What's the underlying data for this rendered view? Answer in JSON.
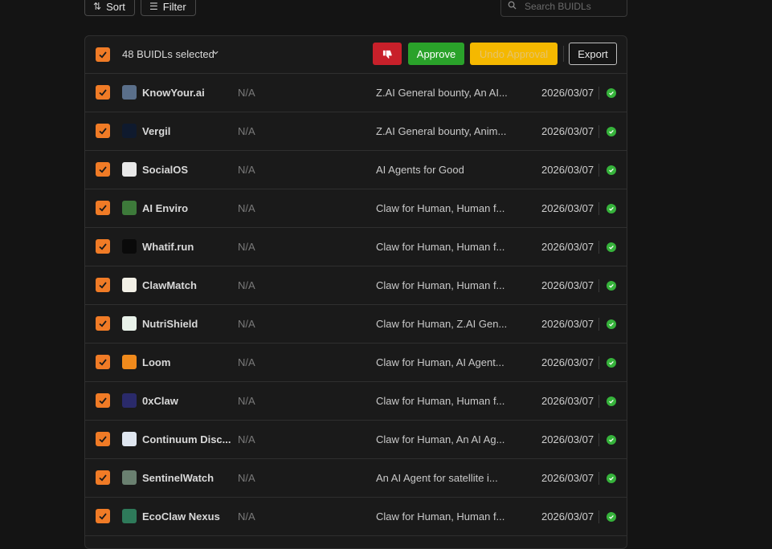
{
  "toolbar": {
    "sort_label": "Sort",
    "filter_label": "Filter",
    "search_placeholder": "Search BUIDLs"
  },
  "selection": {
    "label": "48 BUIDLs selected"
  },
  "actions": {
    "approve_label": "Approve",
    "undo_label": "Undo Approval",
    "export_label": "Export"
  },
  "colors": {
    "accent_orange": "#f07b26",
    "reject_red": "#c8202a",
    "approve_green": "#2aa22a",
    "undo_yellow": "#f5b800",
    "status_green": "#36b33b"
  },
  "rows": [
    {
      "name": "KnowYour.ai",
      "value": "N/A",
      "tracks": "Z.AI General bounty, An AI...",
      "date": "2026/03/07",
      "logo_color": "#5a6f8a",
      "logo_text": ""
    },
    {
      "name": "Vergil",
      "value": "N/A",
      "tracks": "Z.AI General bounty, Anim...",
      "date": "2026/03/07",
      "logo_color": "#0f1a2e",
      "logo_text": ""
    },
    {
      "name": "SocialOS",
      "value": "N/A",
      "tracks": "AI Agents for Good",
      "date": "2026/03/07",
      "logo_color": "#e8e8e8",
      "logo_text": ""
    },
    {
      "name": "AI Enviro",
      "value": "N/A",
      "tracks": "Claw for Human, Human f...",
      "date": "2026/03/07",
      "logo_color": "#3d7a3a",
      "logo_text": ""
    },
    {
      "name": "Whatif.run",
      "value": "N/A",
      "tracks": "Claw for Human, Human f...",
      "date": "2026/03/07",
      "logo_color": "#0a0a0a",
      "logo_text": ""
    },
    {
      "name": "ClawMatch",
      "value": "N/A",
      "tracks": "Claw for Human, Human f...",
      "date": "2026/03/07",
      "logo_color": "#f2f0e6",
      "logo_text": ""
    },
    {
      "name": "NutriShield",
      "value": "N/A",
      "tracks": "Claw for Human, Z.AI Gen...",
      "date": "2026/03/07",
      "logo_color": "#e9f2ea",
      "logo_text": ""
    },
    {
      "name": "Loom",
      "value": "N/A",
      "tracks": "Claw for Human, AI Agent...",
      "date": "2026/03/07",
      "logo_color": "#f08a1c",
      "logo_text": ""
    },
    {
      "name": "0xClaw",
      "value": "N/A",
      "tracks": "Claw for Human, Human f...",
      "date": "2026/03/07",
      "logo_color": "#2a2a6a",
      "logo_text": ""
    },
    {
      "name": "Continuum Disc...",
      "value": "N/A",
      "tracks": "Claw for Human, An AI Ag...",
      "date": "2026/03/07",
      "logo_color": "#dfe6f0",
      "logo_text": ""
    },
    {
      "name": "SentinelWatch",
      "value": "N/A",
      "tracks": "An AI Agent for satellite i...",
      "date": "2026/03/07",
      "logo_color": "#6a8070",
      "logo_text": ""
    },
    {
      "name": "EcoClaw Nexus",
      "value": "N/A",
      "tracks": "Claw for Human, Human f...",
      "date": "2026/03/07",
      "logo_color": "#2e7a5a",
      "logo_text": ""
    }
  ]
}
